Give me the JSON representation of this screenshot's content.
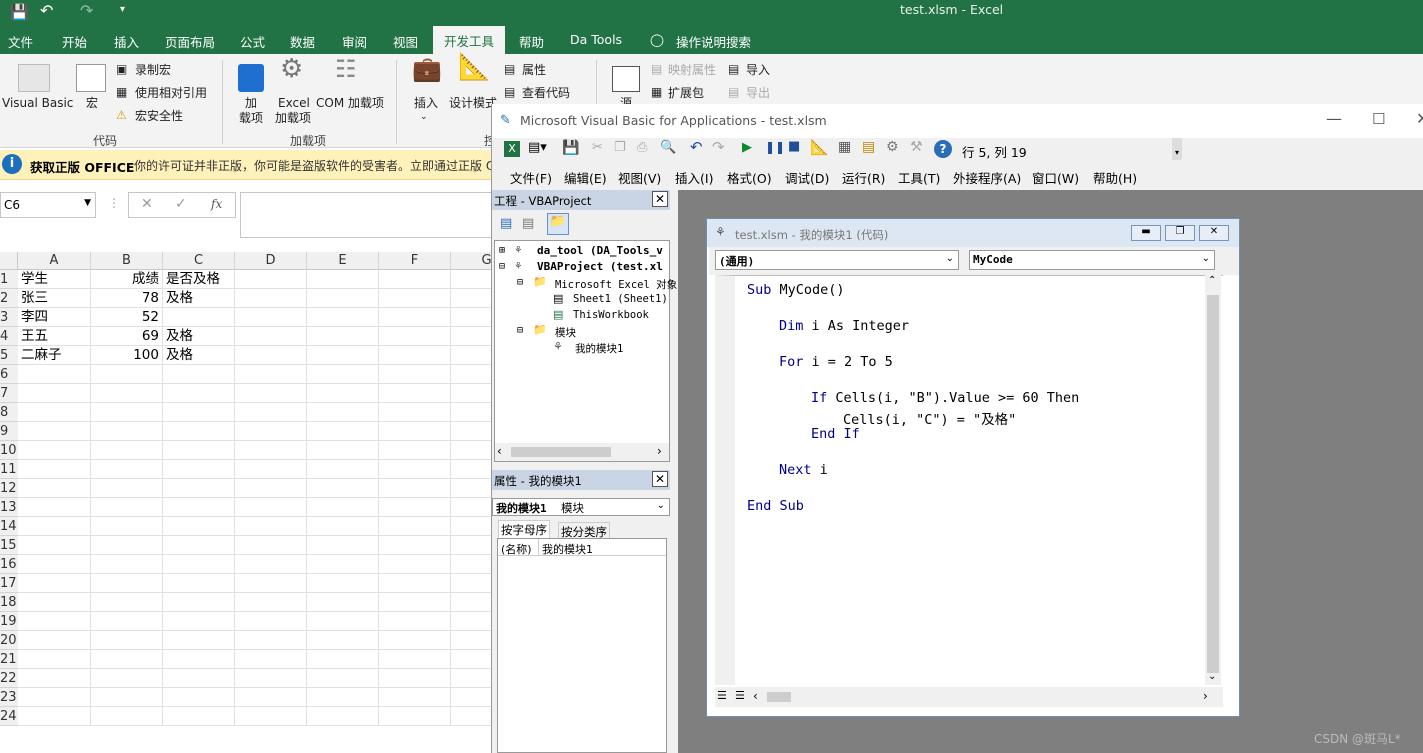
{
  "excel": {
    "title": "test.xlsm  -  Excel",
    "tabs": [
      "文件",
      "开始",
      "插入",
      "页面布局",
      "公式",
      "数据",
      "审阅",
      "视图",
      "开发工具",
      "帮助",
      "Da Tools",
      "操作说明搜索"
    ],
    "ribbon": {
      "visual_basic": "Visual Basic",
      "macro": "宏",
      "record_macro": "录制宏",
      "relative_ref": "使用相对引用",
      "macro_security": "宏安全性",
      "group_code": "代码",
      "add1": "加",
      "add2": "载项",
      "excel_addin1": "Excel",
      "excel_addin2": "加载项",
      "com_addin": "COM 加载项",
      "group_addins": "加载项",
      "insert": "插入",
      "design_mode": "设计模式",
      "properties": "属性",
      "view_code": "查看代码",
      "group_controls": "控",
      "source": "源",
      "map_props": "映射属性",
      "expansion": "扩展包",
      "import": "导入",
      "export": "导出"
    },
    "message_bar": {
      "title": "获取正版 OFFICE",
      "text": "你的许可证并非正版，你可能是盗版软件的受害者。立即通过正版 O"
    },
    "name_box": "C6",
    "fx": "fx",
    "columns": [
      "A",
      "B",
      "C",
      "D",
      "E",
      "F",
      "G"
    ],
    "rows": [
      "1",
      "2",
      "3",
      "4",
      "5",
      "6",
      "7",
      "8",
      "9",
      "10",
      "11",
      "12",
      "13",
      "14",
      "15",
      "16",
      "17",
      "18",
      "19",
      "20",
      "21",
      "22",
      "23",
      "24"
    ],
    "cells": {
      "A1": "学生",
      "B1": "成绩",
      "C1": "是否及格",
      "A2": "张三",
      "B2": "78",
      "C2": "及格",
      "A3": "李四",
      "B3": "52",
      "A4": "王五",
      "B4": "69",
      "C4": "及格",
      "A5": "二麻子",
      "B5": "100",
      "C5": "及格"
    }
  },
  "vbe": {
    "title": "Microsoft Visual Basic for Applications - test.xlsm",
    "position": "行 5, 列 19",
    "menus": [
      "文件(F)",
      "编辑(E)",
      "视图(V)",
      "插入(I)",
      "格式(O)",
      "调试(D)",
      "运行(R)",
      "工具(T)",
      "外接程序(A)",
      "窗口(W)",
      "帮助(H)"
    ],
    "project_title": "工程 - VBAProject",
    "tree": [
      "da_tool (DA_Tools_v",
      "VBAProject (test.xl",
      "Microsoft Excel 对象",
      "Sheet1 (Sheet1)",
      "ThisWorkbook",
      "模块",
      "我的模块1"
    ],
    "props_title": "属性 - 我的模块1",
    "props_object": "我的模块1",
    "props_type": "模块",
    "props_tab_alpha": "按字母序",
    "props_tab_cat": "按分类序",
    "props_name_label": "(名称)",
    "props_name_value": "我的模块1",
    "code_title": "test.xlsm - 我的模块1 (代码)",
    "code_object": "(通用)",
    "code_proc": "MyCode",
    "code": [
      {
        "kw": "Sub",
        "rest": " MyCode()"
      },
      {
        "kw": "Dim",
        "rest": " i As Integer"
      },
      {
        "kw": "For",
        "rest": " i = 2 To 5"
      },
      {
        "kw": "If",
        "rest": " Cells(i, \"B\").Value >= 60 Then"
      },
      {
        "kw": "",
        "rest": "Cells(i, \"C\") = \"及格\""
      },
      {
        "kw": "End If",
        "rest": ""
      },
      {
        "kw": "Next",
        "rest": " i"
      },
      {
        "kw": "End Sub",
        "rest": ""
      }
    ]
  },
  "watermark": "CSDN @斑马L*"
}
